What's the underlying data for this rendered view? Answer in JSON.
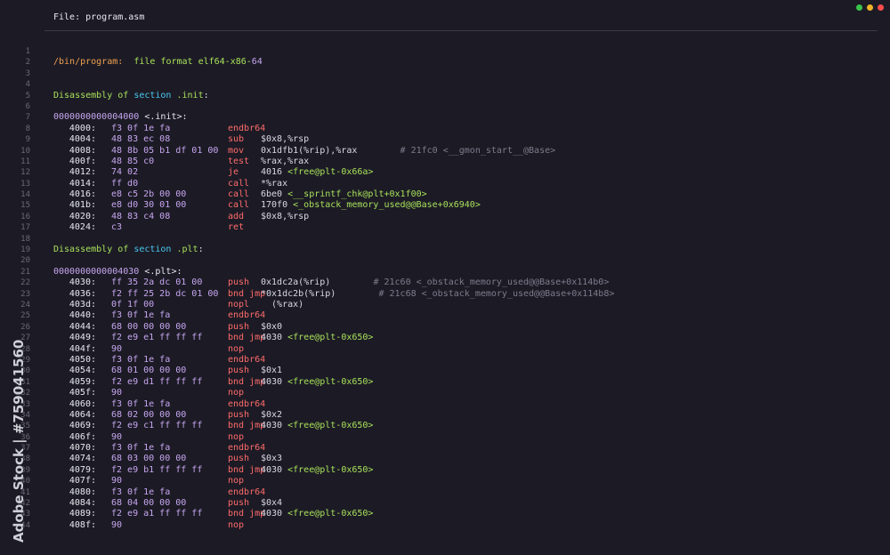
{
  "window": {
    "title": "File: program.asm",
    "controls": [
      {
        "name": "green-dot",
        "color": "#3bc44b"
      },
      {
        "name": "yellow-dot",
        "color": "#f0b429"
      },
      {
        "name": "red-dot",
        "color": "#ff4d4d"
      }
    ]
  },
  "watermark": "Adobe Stock | #759041560",
  "lines": [
    {
      "n": "1",
      "type": "blank"
    },
    {
      "n": "2",
      "type": "header",
      "path": "/bin/program:",
      "rest": "  file format elf64-x86-",
      "num": "64"
    },
    {
      "n": "3",
      "type": "blank"
    },
    {
      "n": "4",
      "type": "blank"
    },
    {
      "n": "5",
      "type": "section",
      "pre": "Disassembly of ",
      "kw": "section",
      "name": " .init",
      "post": ":"
    },
    {
      "n": "6",
      "type": "blank"
    },
    {
      "n": "7",
      "type": "label",
      "addr": "0000000000004000",
      "lbl": " <.init>:"
    },
    {
      "n": "8",
      "type": "ins",
      "addr": "4000:",
      "bytes": "f3 0f 1e fa",
      "mn": "endbr64",
      "ops": "",
      "comment": ""
    },
    {
      "n": "9",
      "type": "ins",
      "addr": "4004:",
      "bytes": "48 83 ec 08",
      "mn": "sub",
      "ops": "$0x8,%rsp",
      "comment": ""
    },
    {
      "n": "10",
      "type": "ins",
      "addr": "4008:",
      "bytes": "48 8b 05 b1 df 01 00",
      "mn": "mov",
      "ops": "0x1dfb1(%rip),%rax",
      "comment": "        # 21fc0 <__gmon_start__@Base>"
    },
    {
      "n": "11",
      "type": "ins",
      "addr": "400f:",
      "bytes": "48 85 c0",
      "mn": "test",
      "ops": "%rax,%rax",
      "comment": ""
    },
    {
      "n": "12",
      "type": "ins",
      "addr": "4012:",
      "bytes": "74 02",
      "mn": "je",
      "ops": "4016 ",
      "tgt": "<free@plt-0x66a>",
      "comment": ""
    },
    {
      "n": "13",
      "type": "ins",
      "addr": "4014:",
      "bytes": "ff d0",
      "mn": "call",
      "ops": "*%rax",
      "comment": ""
    },
    {
      "n": "14",
      "type": "ins",
      "addr": "4016:",
      "bytes": "e8 c5 2b 00 00",
      "mn": "call",
      "ops": "6be0 ",
      "tgt": "<__sprintf_chk@plt+0x1f00>",
      "comment": ""
    },
    {
      "n": "15",
      "type": "ins",
      "addr": "401b:",
      "bytes": "e8 d0 30 01 00",
      "mn": "call",
      "ops": "170f0 ",
      "tgt": "<_obstack_memory_used@@Base+0x6940>",
      "comment": ""
    },
    {
      "n": "16",
      "type": "ins",
      "addr": "4020:",
      "bytes": "48 83 c4 08",
      "mn": "add",
      "ops": "$0x8,%rsp",
      "comment": ""
    },
    {
      "n": "17",
      "type": "ins",
      "addr": "4024:",
      "bytes": "c3",
      "mn": "ret",
      "ops": "",
      "comment": ""
    },
    {
      "n": "18",
      "type": "blank"
    },
    {
      "n": "19",
      "type": "section",
      "pre": "Disassembly of ",
      "kw": "section",
      "name": " .plt",
      "post": ":"
    },
    {
      "n": "20",
      "type": "blank"
    },
    {
      "n": "21",
      "type": "label",
      "addr": "0000000000004030",
      "lbl": " <.plt>:"
    },
    {
      "n": "22",
      "type": "ins",
      "addr": "4030:",
      "bytes": "ff 35 2a dc 01 00",
      "mn": "push",
      "ops": "0x1dc2a(%rip)",
      "comment": "        # 21c60 <_obstack_memory_used@@Base+0x114b0>"
    },
    {
      "n": "23",
      "type": "ins",
      "addr": "4036:",
      "bytes": "f2 ff 25 2b dc 01 00",
      "mn": "bnd jmp",
      "ops": "*0x1dc2b(%rip)",
      "comment": "        # 21c68 <_obstack_memory_used@@Base+0x114b8>"
    },
    {
      "n": "24",
      "type": "ins",
      "addr": "403d:",
      "bytes": "0f 1f 00",
      "mn": "nopl",
      "ops": "  (%rax)",
      "comment": ""
    },
    {
      "n": "25",
      "type": "ins",
      "addr": "4040:",
      "bytes": "f3 0f 1e fa",
      "mn": "endbr64",
      "ops": "",
      "comment": ""
    },
    {
      "n": "26",
      "type": "ins",
      "addr": "4044:",
      "bytes": "68 00 00 00 00",
      "mn": "push",
      "ops": "$0x0",
      "comment": ""
    },
    {
      "n": "27",
      "type": "ins",
      "addr": "4049:",
      "bytes": "f2 e9 e1 ff ff ff",
      "mn": "bnd jmp",
      "ops": "4030 ",
      "tgt": "<free@plt-0x650>",
      "comment": ""
    },
    {
      "n": "28",
      "type": "ins",
      "addr": "404f:",
      "bytes": "90",
      "mn": "nop",
      "ops": "",
      "comment": ""
    },
    {
      "n": "29",
      "type": "ins",
      "addr": "4050:",
      "bytes": "f3 0f 1e fa",
      "mn": "endbr64",
      "ops": "",
      "comment": ""
    },
    {
      "n": "30",
      "type": "ins",
      "addr": "4054:",
      "bytes": "68 01 00 00 00",
      "mn": "push",
      "ops": "$0x1",
      "comment": ""
    },
    {
      "n": "31",
      "type": "ins",
      "addr": "4059:",
      "bytes": "f2 e9 d1 ff ff ff",
      "mn": "bnd jmp",
      "ops": "4030 ",
      "tgt": "<free@plt-0x650>",
      "comment": ""
    },
    {
      "n": "32",
      "type": "ins",
      "addr": "405f:",
      "bytes": "90",
      "mn": "nop",
      "ops": "",
      "comment": ""
    },
    {
      "n": "33",
      "type": "ins",
      "addr": "4060:",
      "bytes": "f3 0f 1e fa",
      "mn": "endbr64",
      "ops": "",
      "comment": ""
    },
    {
      "n": "34",
      "type": "ins",
      "addr": "4064:",
      "bytes": "68 02 00 00 00",
      "mn": "push",
      "ops": "$0x2",
      "comment": ""
    },
    {
      "n": "35",
      "type": "ins",
      "addr": "4069:",
      "bytes": "f2 e9 c1 ff ff ff",
      "mn": "bnd jmp",
      "ops": "4030 ",
      "tgt": "<free@plt-0x650>",
      "comment": ""
    },
    {
      "n": "36",
      "type": "ins",
      "addr": "406f:",
      "bytes": "90",
      "mn": "nop",
      "ops": "",
      "comment": ""
    },
    {
      "n": "37",
      "type": "ins",
      "addr": "4070:",
      "bytes": "f3 0f 1e fa",
      "mn": "endbr64",
      "ops": "",
      "comment": ""
    },
    {
      "n": "38",
      "type": "ins",
      "addr": "4074:",
      "bytes": "68 03 00 00 00",
      "mn": "push",
      "ops": "$0x3",
      "comment": ""
    },
    {
      "n": "39",
      "type": "ins",
      "addr": "4079:",
      "bytes": "f2 e9 b1 ff ff ff",
      "mn": "bnd jmp",
      "ops": "4030 ",
      "tgt": "<free@plt-0x650>",
      "comment": ""
    },
    {
      "n": "40",
      "type": "ins",
      "addr": "407f:",
      "bytes": "90",
      "mn": "nop",
      "ops": "",
      "comment": ""
    },
    {
      "n": "41",
      "type": "ins",
      "addr": "4080:",
      "bytes": "f3 0f 1e fa",
      "mn": "endbr64",
      "ops": "",
      "comment": ""
    },
    {
      "n": "42",
      "type": "ins",
      "addr": "4084:",
      "bytes": "68 04 00 00 00",
      "mn": "push",
      "ops": "$0x4",
      "comment": ""
    },
    {
      "n": "43",
      "type": "ins",
      "addr": "4089:",
      "bytes": "f2 e9 a1 ff ff ff",
      "mn": "bnd jmp",
      "ops": "4030 ",
      "tgt": "<free@plt-0x650>",
      "comment": ""
    },
    {
      "n": "44",
      "type": "ins",
      "addr": "408f:",
      "bytes": "90",
      "mn": "nop",
      "ops": "",
      "comment": ""
    }
  ]
}
